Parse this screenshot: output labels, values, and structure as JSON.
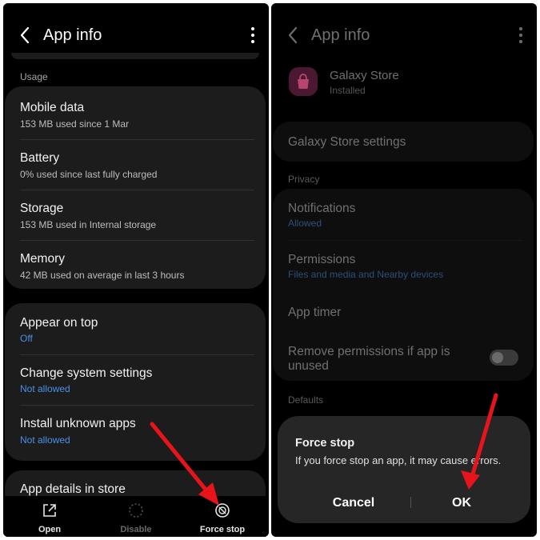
{
  "left": {
    "appbar": {
      "title": "App info"
    },
    "usage_label": "Usage",
    "usage_items": [
      {
        "title": "Mobile data",
        "subtitle": "153 MB used since 1 Mar"
      },
      {
        "title": "Battery",
        "subtitle": "0% used since last fully charged"
      },
      {
        "title": "Storage",
        "subtitle": "153 MB used in Internal storage"
      },
      {
        "title": "Memory",
        "subtitle": "42 MB used on average in last 3 hours"
      }
    ],
    "perm_items": [
      {
        "title": "Appear on top",
        "subtitle": "Off"
      },
      {
        "title": "Change system settings",
        "subtitle": "Not allowed"
      },
      {
        "title": "Install unknown apps",
        "subtitle": "Not allowed"
      }
    ],
    "store_item": {
      "title": "App details in store"
    },
    "bottom_nav": {
      "open": "Open",
      "disable": "Disable",
      "force_stop": "Force stop"
    }
  },
  "right": {
    "appbar": {
      "title": "App info"
    },
    "app": {
      "name": "Galaxy Store",
      "status": "Installed"
    },
    "settings_item": "Galaxy Store settings",
    "privacy_label": "Privacy",
    "privacy_items": [
      {
        "title": "Notifications",
        "subtitle": "Allowed"
      },
      {
        "title": "Permissions",
        "subtitle": "Files and media and Nearby devices"
      },
      {
        "title": "App timer",
        "subtitle": ""
      },
      {
        "title": "Remove permissions if app is unused",
        "subtitle": ""
      }
    ],
    "toggle_on": false,
    "defaults_label": "Defaults",
    "dialog": {
      "title": "Force stop",
      "message": "If you force stop an app, it may cause errors.",
      "cancel": "Cancel",
      "ok": "OK"
    }
  },
  "colors": {
    "accent_blue": "#4a90e6",
    "arrow_red": "#e8141c",
    "card": "#1c1c1c"
  }
}
